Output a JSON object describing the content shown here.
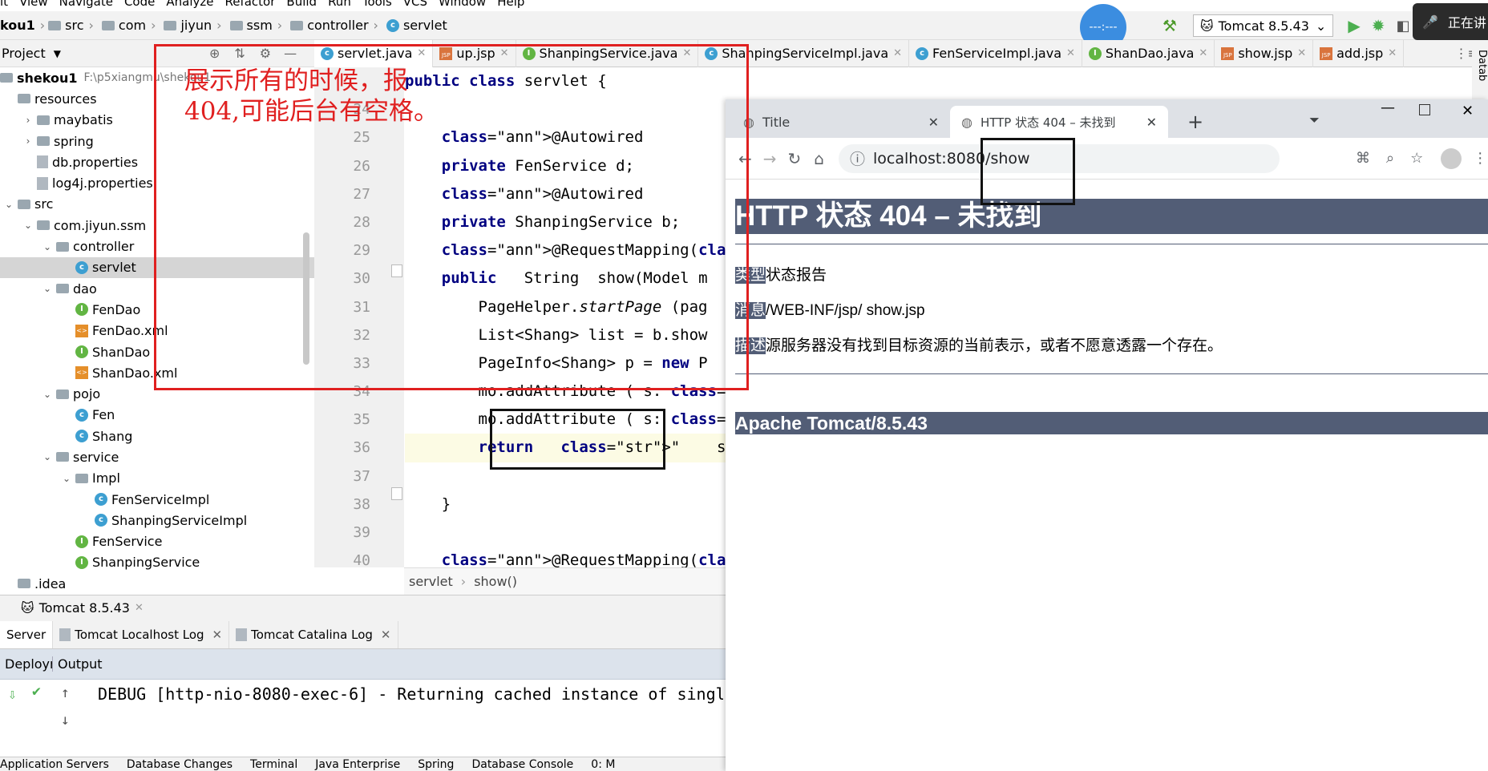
{
  "menu": [
    "it",
    "View",
    "Navigate",
    "Code",
    "Analyze",
    "Refactor",
    "Build",
    "Run",
    "Tools",
    "VCS",
    "Window",
    "Help"
  ],
  "nav": {
    "project": "kou1",
    "crumbs": [
      "src",
      "com",
      "jiyun",
      "ssm",
      "controller",
      "servlet"
    ]
  },
  "run": {
    "config": "Tomcat 8.5.43",
    "status_text": "正在讲"
  },
  "project_panel": {
    "title": "Project",
    "root_name": "shekou1",
    "root_path": "F:\\p5xiangmu\\shekou1"
  },
  "tree": [
    {
      "label": "resources",
      "indent": 0,
      "arrow": "",
      "icon": "folder"
    },
    {
      "label": "maybatis",
      "indent": 1,
      "arrow": "›",
      "icon": "folder"
    },
    {
      "label": "spring",
      "indent": 1,
      "arrow": "›",
      "icon": "folder"
    },
    {
      "label": "db.properties",
      "indent": 1,
      "arrow": "",
      "icon": "file"
    },
    {
      "label": "log4j.properties",
      "indent": 1,
      "arrow": "",
      "icon": "file"
    },
    {
      "label": "src",
      "indent": 0,
      "arrow": "⌄",
      "icon": "folder"
    },
    {
      "label": "com.jiyun.ssm",
      "indent": 1,
      "arrow": "⌄",
      "icon": "folder"
    },
    {
      "label": "controller",
      "indent": 2,
      "arrow": "⌄",
      "icon": "folder"
    },
    {
      "label": "servlet",
      "indent": 3,
      "arrow": "",
      "icon": "c",
      "sel": true
    },
    {
      "label": "dao",
      "indent": 2,
      "arrow": "⌄",
      "icon": "folder"
    },
    {
      "label": "FenDao",
      "indent": 3,
      "arrow": "",
      "icon": "i"
    },
    {
      "label": "FenDao.xml",
      "indent": 3,
      "arrow": "",
      "icon": "xml"
    },
    {
      "label": "ShanDao",
      "indent": 3,
      "arrow": "",
      "icon": "i"
    },
    {
      "label": "ShanDao.xml",
      "indent": 3,
      "arrow": "",
      "icon": "xml"
    },
    {
      "label": "pojo",
      "indent": 2,
      "arrow": "⌄",
      "icon": "folder"
    },
    {
      "label": "Fen",
      "indent": 3,
      "arrow": "",
      "icon": "c"
    },
    {
      "label": "Shang",
      "indent": 3,
      "arrow": "",
      "icon": "c"
    },
    {
      "label": "service",
      "indent": 2,
      "arrow": "⌄",
      "icon": "folder"
    },
    {
      "label": "Impl",
      "indent": 3,
      "arrow": "⌄",
      "icon": "folder"
    },
    {
      "label": "FenServiceImpl",
      "indent": 4,
      "arrow": "",
      "icon": "c"
    },
    {
      "label": "ShanpingServiceImpl",
      "indent": 4,
      "arrow": "",
      "icon": "c"
    },
    {
      "label": "FenService",
      "indent": 3,
      "arrow": "",
      "icon": "i"
    },
    {
      "label": "ShanpingService",
      "indent": 3,
      "arrow": "",
      "icon": "i"
    },
    {
      "label": ".idea",
      "indent": 0,
      "arrow": "",
      "icon": "folder"
    }
  ],
  "editor_tabs": [
    {
      "label": "servlet.java",
      "icon": "c",
      "active": true
    },
    {
      "label": "up.jsp",
      "icon": "jsp"
    },
    {
      "label": "ShanpingService.java",
      "icon": "i"
    },
    {
      "label": "ShanpingServiceImpl.java",
      "icon": "c"
    },
    {
      "label": "FenServiceImpl.java",
      "icon": "c"
    },
    {
      "label": "ShanDao.java",
      "icon": "i"
    },
    {
      "label": "show.jsp",
      "icon": "jsp"
    },
    {
      "label": "add.jsp",
      "icon": "jsp"
    }
  ],
  "line_numbers": [
    "",
    "24",
    "25",
    "26",
    "27",
    "28",
    "29",
    "30",
    "31",
    "32",
    "33",
    "34",
    "35",
    "36",
    "37",
    "38",
    "39",
    "40"
  ],
  "code_lines": [
    "public class servlet {",
    "",
    "    @Autowired",
    "    private FenService d;",
    "    @Autowired",
    "    private ShanpingService b;",
    "    @RequestMapping(\"show\")",
    "    public   String  show(Model m",
    "        PageHelper.startPage (pag",
    "        List<Shang> list = b.show",
    "        PageInfo<Shang> p = new P",
    "        mo.addAttribute ( s: \"p\",p",
    "        mo.addAttribute ( s: \"a1\",",
    "        return   \"    show\"",
    "",
    "    }",
    "",
    "    @RequestMapping(\"shan\")"
  ],
  "editor_crumb": [
    "servlet",
    "show()"
  ],
  "services": {
    "title": "Tomcat 8.5.43",
    "tabs": [
      "Server",
      "Tomcat Localhost Log",
      "Tomcat Catalina Log"
    ],
    "deploy_label": "Deploym",
    "output_label": "Output",
    "log_line": "DEBUG [http-nio-8080-exec-6] - Returning cached instance of singl"
  },
  "bottom_tools": [
    "Application Servers",
    "Database Changes",
    "Terminal",
    "Java Enterprise",
    "Spring",
    "Database Console",
    "0: M"
  ],
  "annotation": {
    "note": "展示所有的时候，报404,可能后台有空格。"
  },
  "browser": {
    "tabs": [
      {
        "title": "Title"
      },
      {
        "title": "HTTP 状态 404 – 未找到"
      }
    ],
    "url": "localhost:8080/show",
    "heading": "HTTP 状态 404 – 未找到",
    "type_label": "类型",
    "type_text": "状态报告",
    "msg_label": "消息",
    "msg_text": "/WEB-INF/jsp/ show.jsp",
    "desc_label": "描述",
    "desc_text": "源服务器没有找到目标资源的当前表示，或者不愿意透露一个存在。",
    "footer": "Apache Tomcat/8.5.43"
  },
  "side_label": "Datab"
}
